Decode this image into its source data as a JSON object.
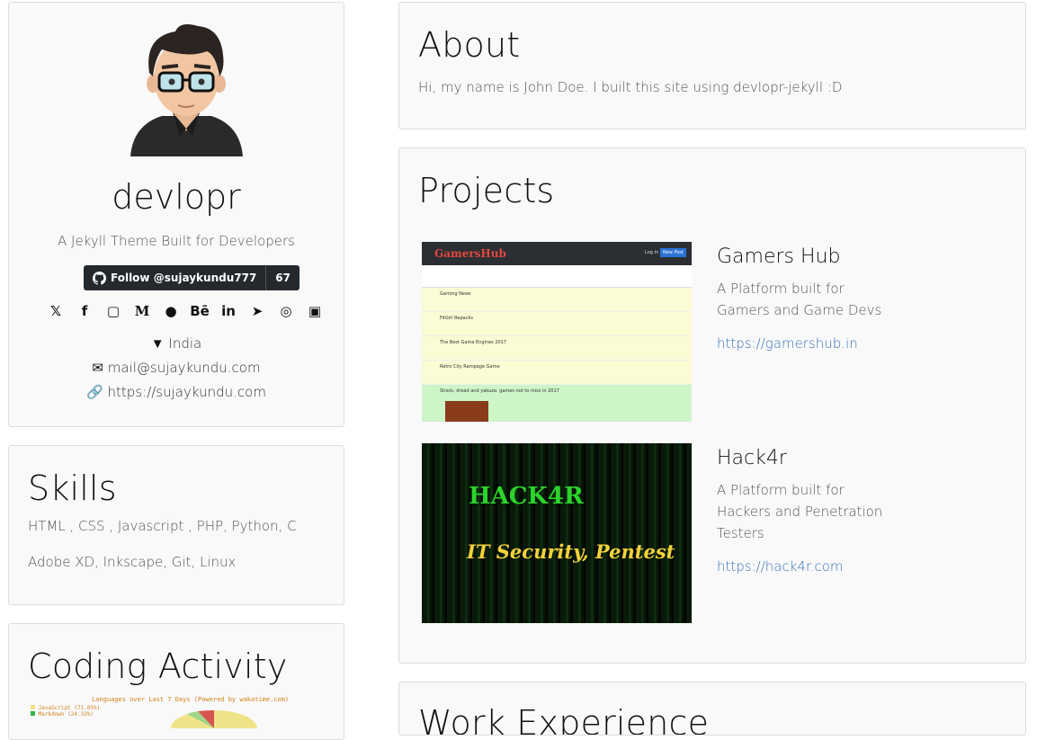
{
  "profile": {
    "name": "devlopr",
    "tagline": "A Jekyll Theme Built for Developers",
    "github_follow": "Follow @sujaykundu777",
    "github_count": "67",
    "social_icons": [
      "twitter-icon",
      "facebook-icon",
      "instagram-icon",
      "medium-icon",
      "github-icon",
      "behance-icon",
      "linkedin-icon",
      "telegram-icon",
      "dribbble-icon",
      "flickr-icon"
    ],
    "location": "India",
    "email": "mail@sujaykundu.com",
    "website": "https://sujaykundu.com"
  },
  "skills": {
    "title": "Skills",
    "line1": "HTML , CSS , Javascript , PHP, Python, C",
    "line2": "Adobe XD, Inkscape, Git, Linux"
  },
  "coding": {
    "title": "Coding Activity",
    "chart_caption": "Languages over Last 7 Days (Powered by wakatime.com)",
    "legend": [
      "JavaScript (71.05%)",
      "Markdown (24.32%)"
    ]
  },
  "about": {
    "title": "About",
    "text": "Hi, my name is John Doe. I built this site using devlopr-jekyll :D"
  },
  "projects": {
    "title": "Projects",
    "items": [
      {
        "name": "Gamers Hub",
        "desc": "A Platform built for Gamers and Game Devs",
        "url": "https://gamershub.in",
        "thumb_logo": "GamersHub",
        "thumb_login": "Log In ▾",
        "thumb_new": "New Post",
        "thumb_posts": [
          "Gaming News",
          "FitGirl Repacks",
          "The Best Game Engines 2017",
          "Retro City Rampage Game",
          "Shock, dread and yakuza: games not to miss in 2017"
        ]
      },
      {
        "name": "Hack4r",
        "desc": "A Platform built for Hackers and Penetration Testers",
        "url": "https://hack4r.com",
        "thumb_title": "HACK4R",
        "thumb_sub": "IT Security, Pentest"
      }
    ]
  },
  "work": {
    "title": "Work Experience"
  }
}
